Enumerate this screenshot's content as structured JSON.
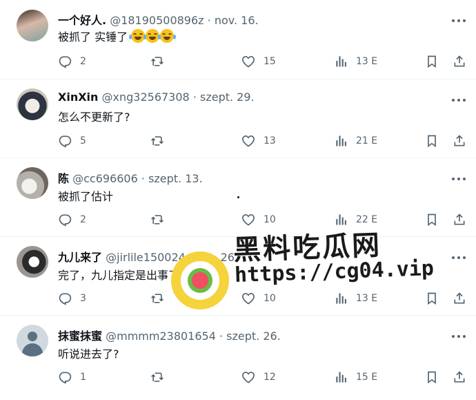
{
  "tweets": [
    {
      "name": "一个好人.",
      "handle": "@18190500896z",
      "date": "nov. 16.",
      "text": "被抓了 实锤了",
      "emoji_count": 3,
      "replies": "2",
      "retweets": "",
      "likes": "15",
      "views": "13 E"
    },
    {
      "name": "XinXin",
      "handle": "@xng32567308",
      "date": "szept. 29.",
      "text": "怎么不更新了?",
      "emoji_count": 0,
      "replies": "5",
      "retweets": "",
      "likes": "13",
      "views": "21 E"
    },
    {
      "name": "陈",
      "handle": "@cc696606",
      "date": "szept. 13.",
      "text": "被抓了估计",
      "emoji_count": 0,
      "replies": "2",
      "retweets": "",
      "likes": "10",
      "views": "22 E"
    },
    {
      "name": "九儿来了",
      "handle": "@jirlile150024",
      "date": "okt. 26.",
      "text": "完了，九儿指定是出事了",
      "emoji_count": 0,
      "replies": "3",
      "retweets": "",
      "likes": "10",
      "views": "13 E"
    },
    {
      "name": "抹蜜抹蜜",
      "handle": "@mmmm23801654",
      "date": "szept. 26.",
      "text": "听说进去了?",
      "emoji_count": 0,
      "replies": "1",
      "retweets": "",
      "likes": "12",
      "views": "15 E"
    }
  ],
  "separator": "·",
  "watermark": {
    "title": "黑料吃瓜网",
    "url": "https://cg04.vip"
  },
  "icons": [
    "reply-icon",
    "retweet-icon",
    "like-icon",
    "views-icon",
    "bookmark-icon",
    "share-icon",
    "more-icon"
  ],
  "colors": {
    "text": "#0f1419",
    "secondary": "#536471",
    "border": "#eff3f4",
    "watermark_yellow": "#f5d33a"
  }
}
